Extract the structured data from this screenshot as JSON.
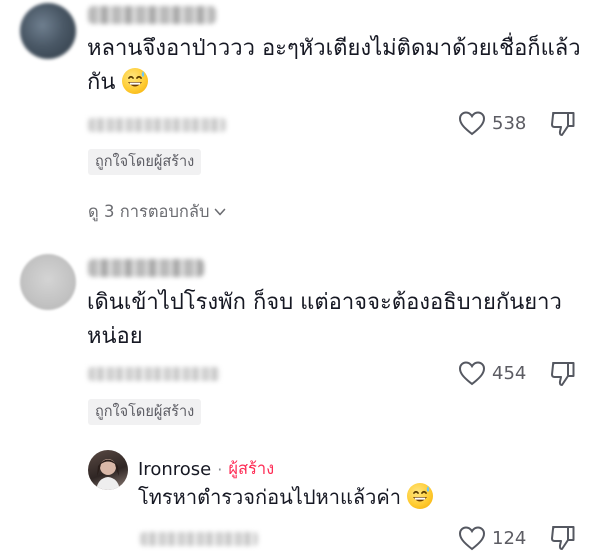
{
  "comments": [
    {
      "text": "หลานจึงอาป่าววว อะๆหัวเตียงไม่ติดมาด้วยเชื่อก็แล้วกัน",
      "line1": "หลานจึงอาป่าววว อะๆหัวเตียงไม่ติดมาด้วยเชื่อก็แล้ว",
      "line2": "กัน",
      "emoji": "grinning-sweat-emoji",
      "likes": "538",
      "liked_by_creator": "ถูกใจโดยผู้สร้าง",
      "view_replies": "ดู 3 การตอบกลับ"
    },
    {
      "text": "เดินเข้าไปโรงพัก ก็จบ แต่อาจจะต้องอธิบายกันยาวหน่อย",
      "line1": "เดินเข้าไปโรงพัก ก็จบ แต่อาจจะต้องอธิบายกันยาว",
      "line2": "หน่อย",
      "likes": "454",
      "liked_by_creator": "ถูกใจโดยผู้สร้าง",
      "reply": {
        "name": "Ironrose",
        "separator": "·",
        "role": "ผู้สร้าง",
        "text": "โทรหาตำรวจก่อนไปหาแล้วค่า",
        "emoji": "grinning-sweat-emoji",
        "likes": "124"
      }
    }
  ],
  "icons": {
    "like": "heart-outline-icon",
    "dislike": "thumbs-down-outline-icon",
    "chevron": "chevron-down-icon"
  },
  "colors": {
    "creator_accent": "#fe2c55",
    "secondary_text": "#5c5c63",
    "badge_bg": "#f1f1f2"
  }
}
